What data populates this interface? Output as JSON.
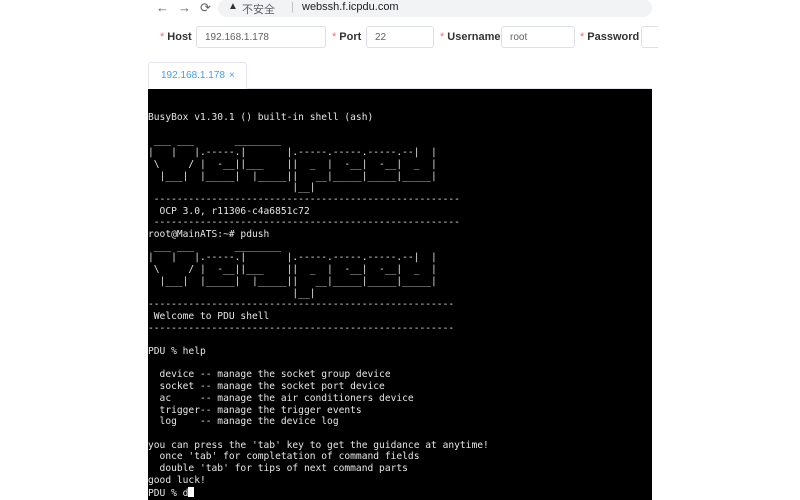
{
  "browser": {
    "back_icon": "←",
    "forward_icon": "→",
    "reload_icon": "⟳",
    "warning_icon": "▲",
    "insecure_label": "不安全",
    "separator": "|",
    "url": "webssh.f.icpdu.com"
  },
  "form": {
    "host_label": "Host",
    "host_value": "192.168.1.178",
    "port_label": "Port",
    "port_value": "22",
    "username_label": "Username",
    "username_value": "root",
    "password_label": "Password",
    "required_mark": "*"
  },
  "tabs": [
    {
      "label": "192.168.1.178",
      "close": "×"
    }
  ],
  "terminal": {
    "output": "BusyBox v1.30.1 () built-in shell (ash)\n\n ___ ___       ________\n|   |   |.-----.|       |.-----.-----.-----.--|  |\n \\     / |  -__||___    ||  _  |  -__|  -__|  _  |\n  |___|  |_____|  |_____||   __|_____|_____|_____|\n                         |__|\n -----------------------------------------------------\n  OCP 3.0, r11306-c4a6851c72\n -----------------------------------------------------\nroot@MainATS:~# pdush\n ___ ___       ________\n|   |   |.-----.|       |.-----.-----.-----.--|  |\n \\     / |  -__||___    ||  _  |  -__|  -__|  _  |\n  |___|  |_____|  |_____||   __|_____|_____|_____|\n                         |__|\n-----------------------------------------------------\n Welcome to PDU shell\n-----------------------------------------------------\n\nPDU % help\n\n  device -- manage the socket group device\n  socket -- manage the socket port device\n  ac     -- manage the air conditioners device\n  trigger-- manage the trigger events\n  log    -- manage the device log\n\nyou can press the 'tab' key to get the guidance at anytime!\n  once 'tab' for completation of command fields\n  double 'tab' for tips of next command parts\ngood luck!\nPDU % ",
    "input": "d"
  }
}
